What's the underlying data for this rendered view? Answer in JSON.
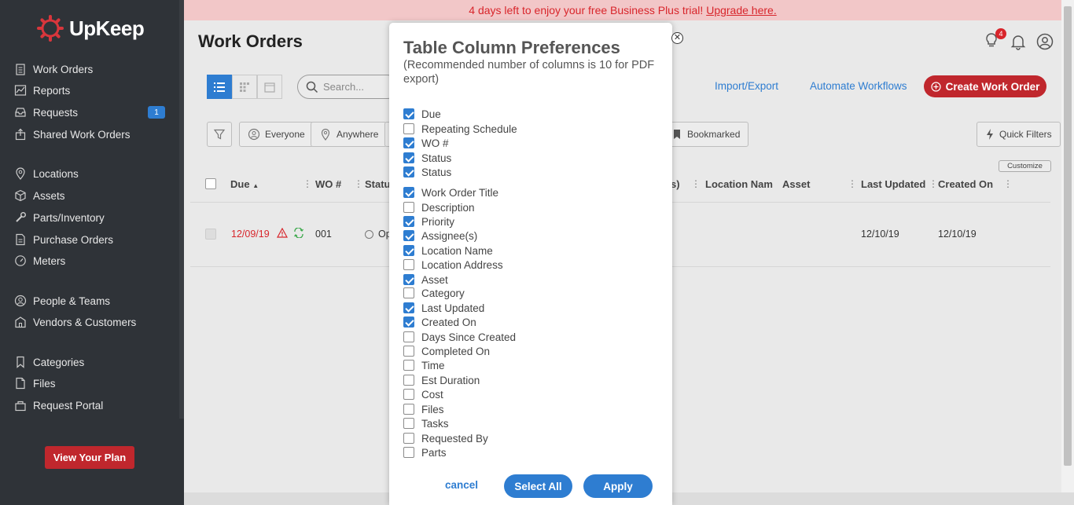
{
  "app": {
    "name": "UpKeep"
  },
  "sidebar": {
    "items": [
      {
        "label": "Work Orders",
        "icon": "clipboard-icon"
      },
      {
        "label": "Reports",
        "icon": "chart-icon"
      },
      {
        "label": "Requests",
        "icon": "inbox-icon",
        "badge": "1"
      },
      {
        "label": "Shared Work Orders",
        "icon": "share-icon"
      },
      {
        "label": "Locations",
        "icon": "location-pin-icon"
      },
      {
        "label": "Assets",
        "icon": "cube-icon"
      },
      {
        "label": "Parts/Inventory",
        "icon": "wrench-icon"
      },
      {
        "label": "Purchase Orders",
        "icon": "document-icon"
      },
      {
        "label": "Meters",
        "icon": "gauge-icon"
      },
      {
        "label": "People & Teams",
        "icon": "people-icon"
      },
      {
        "label": "Vendors & Customers",
        "icon": "building-icon"
      },
      {
        "label": "Categories",
        "icon": "bookmark-icon"
      },
      {
        "label": "Files",
        "icon": "file-icon"
      },
      {
        "label": "Request Portal",
        "icon": "portal-icon"
      }
    ],
    "plan_button": "View Your Plan"
  },
  "banner": {
    "text": "4 days left to enjoy your free Business Plus trial!",
    "link": "Upgrade here."
  },
  "header": {
    "title": "Work Orders",
    "notification_count": "4"
  },
  "toolbar": {
    "search_placeholder": "Search...",
    "import_export": "Import/Export",
    "automate": "Automate Workflows",
    "create": "Create Work Order"
  },
  "filters": {
    "everyone": "Everyone",
    "anywhere": "Anywhere",
    "bookmarked": "Bookmarked",
    "quick_filters": "Quick Filters",
    "customize": "Customize"
  },
  "table": {
    "headers": {
      "due": "Due",
      "wo": "WO #",
      "status": "Statu",
      "assignees_tail": "s)",
      "location": "Location Nam",
      "asset": "Asset",
      "last_updated": "Last Updated",
      "created_on": "Created On"
    },
    "row": {
      "due": "12/09/19",
      "wo": "001",
      "status": "Op",
      "last_updated": "12/10/19",
      "created_on": "12/10/19"
    }
  },
  "modal": {
    "title": "Table Column Preferences",
    "subtitle": "(Recommended number of columns is 10 for PDF export)",
    "options": [
      {
        "label": "Due",
        "checked": true
      },
      {
        "label": "Repeating Schedule",
        "checked": false
      },
      {
        "label": "WO #",
        "checked": true
      },
      {
        "label": "Status",
        "checked": true
      },
      {
        "label": "Status",
        "checked": true
      },
      {
        "label": "Work Order Title",
        "checked": true
      },
      {
        "label": "Description",
        "checked": false
      },
      {
        "label": "Priority",
        "checked": true
      },
      {
        "label": "Assignee(s)",
        "checked": true
      },
      {
        "label": "Location Name",
        "checked": true
      },
      {
        "label": "Location Address",
        "checked": false
      },
      {
        "label": "Asset",
        "checked": true
      },
      {
        "label": "Category",
        "checked": false
      },
      {
        "label": "Last Updated",
        "checked": true
      },
      {
        "label": "Created On",
        "checked": true
      },
      {
        "label": "Days Since Created",
        "checked": false
      },
      {
        "label": "Completed On",
        "checked": false
      },
      {
        "label": "Time",
        "checked": false
      },
      {
        "label": "Est Duration",
        "checked": false
      },
      {
        "label": "Cost",
        "checked": false
      },
      {
        "label": "Files",
        "checked": false
      },
      {
        "label": "Tasks",
        "checked": false
      },
      {
        "label": "Requested By",
        "checked": false
      },
      {
        "label": "Parts",
        "checked": false
      }
    ],
    "cancel": "cancel",
    "select_all": "Select All",
    "apply": "Apply"
  },
  "colors": {
    "accent": "#2e7dd1",
    "brand_red": "#c0272d",
    "sidebar": "#2f3338"
  }
}
